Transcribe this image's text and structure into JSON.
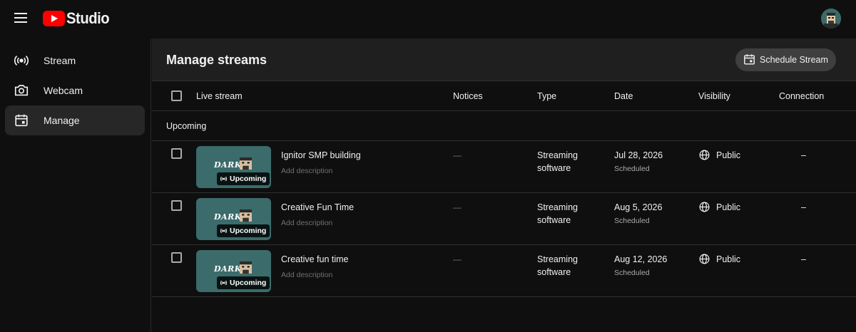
{
  "app": {
    "logo_text": "Studio"
  },
  "sidebar": {
    "items": [
      {
        "label": "Stream",
        "icon": "broadcast-icon"
      },
      {
        "label": "Webcam",
        "icon": "camera-icon"
      },
      {
        "label": "Manage",
        "icon": "calendar-icon",
        "active": true
      }
    ]
  },
  "main": {
    "title": "Manage streams",
    "schedule_button": "Schedule Stream",
    "columns": [
      "Live stream",
      "Notices",
      "Type",
      "Date",
      "Visibility",
      "Connection"
    ],
    "section": "Upcoming",
    "rows": [
      {
        "thumb_brand": "DARKE",
        "badge": "Upcoming",
        "title": "Ignitor SMP building",
        "description": "Add description",
        "notice": "—",
        "type_line1": "Streaming",
        "type_line2": "software",
        "date": "Jul 28, 2026",
        "status": "Scheduled",
        "visibility": "Public",
        "connection": "–"
      },
      {
        "thumb_brand": "DARKE",
        "badge": "Upcoming",
        "title": "Creative Fun Time",
        "description": "Add description",
        "notice": "—",
        "type_line1": "Streaming",
        "type_line2": "software",
        "date": "Aug 5, 2026",
        "status": "Scheduled",
        "visibility": "Public",
        "connection": "–"
      },
      {
        "thumb_brand": "DARKE",
        "badge": "Upcoming",
        "title": "Creative fun time",
        "description": "Add description",
        "notice": "—",
        "type_line1": "Streaming",
        "type_line2": "software",
        "date": "Aug 12, 2026",
        "status": "Scheduled",
        "visibility": "Public",
        "connection": "–"
      }
    ]
  },
  "colors": {
    "accent": "#ff0000",
    "background": "#0f0f0f",
    "header": "#1f1f1f",
    "thumb": "#3b6b6b"
  }
}
